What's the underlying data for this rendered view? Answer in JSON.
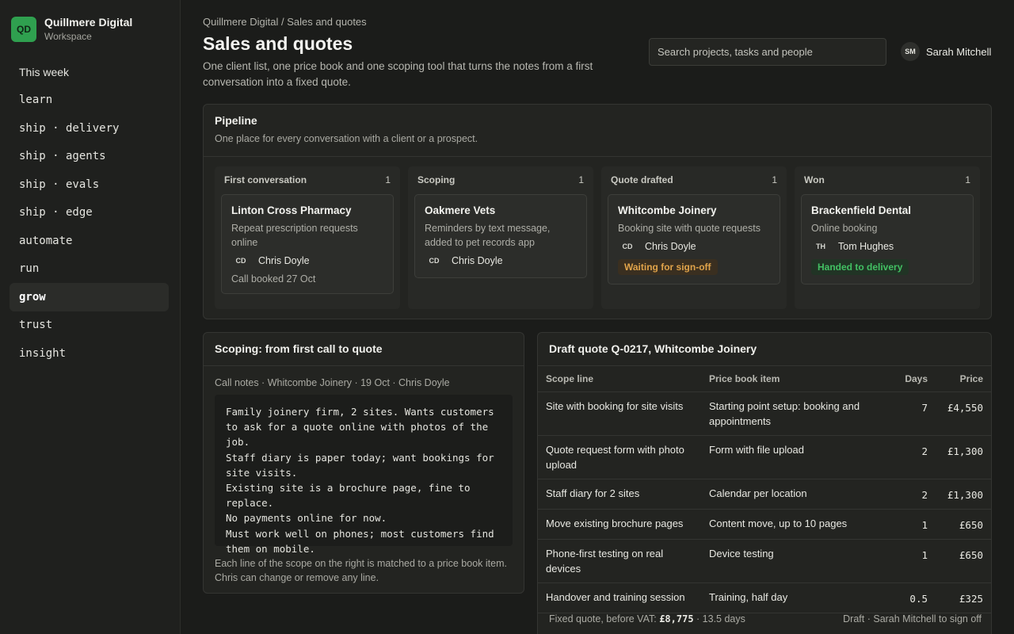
{
  "workspace": {
    "initials": "QD",
    "name": "Quillmere Digital",
    "sub": "Workspace"
  },
  "nav": [
    {
      "label": "This week",
      "mono": false,
      "active": false
    },
    {
      "label": "learn",
      "mono": true,
      "active": false
    },
    {
      "label": "ship · delivery",
      "mono": true,
      "active": false
    },
    {
      "label": "ship · agents",
      "mono": true,
      "active": false
    },
    {
      "label": "ship · evals",
      "mono": true,
      "active": false
    },
    {
      "label": "ship · edge",
      "mono": true,
      "active": false
    },
    {
      "label": "automate",
      "mono": true,
      "active": false
    },
    {
      "label": "run",
      "mono": true,
      "active": false
    },
    {
      "label": "grow",
      "mono": true,
      "active": true
    },
    {
      "label": "trust",
      "mono": true,
      "active": false
    },
    {
      "label": "insight",
      "mono": true,
      "active": false
    }
  ],
  "header": {
    "breadcrumb": "Quillmere Digital / Sales and quotes",
    "title": "Sales and quotes",
    "subtitle": "One client list, one price book and one scoping tool that turns the notes from a first conversation into a fixed quote.",
    "search_placeholder": "Search projects, tasks and people",
    "user_initials": "SM",
    "user_name": "Sarah Mitchell"
  },
  "pipeline": {
    "title": "Pipeline",
    "desc": "One place for every conversation with a client or a prospect.",
    "columns": [
      {
        "name": "First conversation",
        "count": "1",
        "card": {
          "title": "Linton Cross Pharmacy",
          "desc": "Repeat prescription requests online",
          "initials": "CD",
          "person": "Chris Doyle",
          "note": "Call booked 27 Oct"
        }
      },
      {
        "name": "Scoping",
        "count": "1",
        "card": {
          "title": "Oakmere Vets",
          "desc": "Reminders by text message, added to pet records app",
          "initials": "CD",
          "person": "Chris Doyle"
        }
      },
      {
        "name": "Quote drafted",
        "count": "1",
        "card": {
          "title": "Whitcombe Joinery",
          "desc": "Booking site with quote requests",
          "initials": "CD",
          "person": "Chris Doyle",
          "badge": "Waiting for sign-off"
        }
      },
      {
        "name": "Won",
        "count": "1",
        "card": {
          "title": "Brackenfield Dental",
          "desc": "Online booking",
          "initials": "TH",
          "person": "Tom Hughes",
          "badge": "Handed to delivery"
        }
      }
    ]
  },
  "scoping": {
    "title": "Scoping: from first call to quote",
    "meta": "Call notes · Whitcombe Joinery · 19 Oct · Chris Doyle",
    "notes": "Family joinery firm, 2 sites. Wants customers to ask for a quote online with photos of the job.\nStaff diary is paper today; want bookings for site visits.\nExisting site is a brochure page, fine to replace.\nNo payments online for now.\nMust work well on phones; most customers find them on mobile.",
    "footer": "Each line of the scope on the right is matched to a price book item. Chris can change or remove any line."
  },
  "quote": {
    "title": "Draft quote Q-0217, Whitcombe Joinery",
    "headers": {
      "scope": "Scope line",
      "item": "Price book item",
      "days": "Days",
      "price": "Price"
    },
    "rows": [
      {
        "scope": "Site with booking for site visits",
        "item": "Starting point setup: booking and appointments",
        "days": "7",
        "price": "£4,550"
      },
      {
        "scope": "Quote request form with photo upload",
        "item": "Form with file upload",
        "days": "2",
        "price": "£1,300"
      },
      {
        "scope": "Staff diary for 2 sites",
        "item": "Calendar per location",
        "days": "2",
        "price": "£1,300"
      },
      {
        "scope": "Move existing brochure pages",
        "item": "Content move, up to 10 pages",
        "days": "1",
        "price": "£650"
      },
      {
        "scope": "Phone-first testing on real devices",
        "item": "Device testing",
        "days": "1",
        "price": "£650"
      },
      {
        "scope": "Handover and training session",
        "item": "Training, half day",
        "days": "0.5",
        "price": "£325"
      }
    ],
    "footer_prefix": "Fixed quote, before VAT: ",
    "footer_total": "£8,775",
    "footer_days": " · 13.5 days",
    "footer_status": "Draft · Sarah Mitchell to sign off"
  }
}
